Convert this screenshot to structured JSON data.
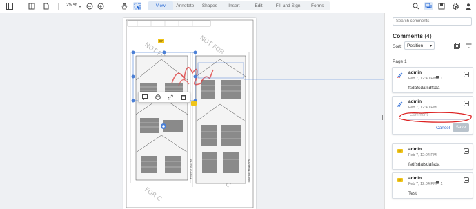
{
  "toolbar": {
    "zoom": "25 %",
    "tabs": [
      "View",
      "Annotate",
      "Shapes",
      "Insert",
      "Edit",
      "Fill and Sign",
      "Forms"
    ],
    "active_tab": "View"
  },
  "panel": {
    "search_placeholder": "Search comments",
    "title": "Comments",
    "count": "(4)",
    "sort_label": "Sort:",
    "sort_value": "Position",
    "page_label": "Page 1",
    "cancel_label": "Cancel",
    "save_label": "Save",
    "reply_placeholder": "Comment",
    "comments": [
      {
        "author": "admin",
        "date": "Feb 7, 12:40 PM",
        "replies": "1",
        "text": "fsdafsdafsdfsda",
        "icon": "freehand-icon",
        "icon_color": "#2b6bd6"
      },
      {
        "author": "admin",
        "date": "Feb 7, 12:40 PM",
        "replies": "",
        "text": "",
        "icon": "freehand-icon",
        "icon_color": "#2b6bd6"
      },
      {
        "author": "admin",
        "date": "Feb 7, 12:04 PM",
        "replies": "",
        "text": "fsdfsdafsdafsda",
        "icon": "note-icon",
        "icon_color": "#e9c31a"
      },
      {
        "author": "admin",
        "date": "Feb 7, 12:04 PM",
        "replies": "1",
        "text": "Test",
        "icon": "note-icon",
        "icon_color": "#e9c31a"
      }
    ]
  },
  "colors": {
    "accent": "#2b6bd6",
    "ink": "#d22",
    "note": "#f0c419"
  }
}
